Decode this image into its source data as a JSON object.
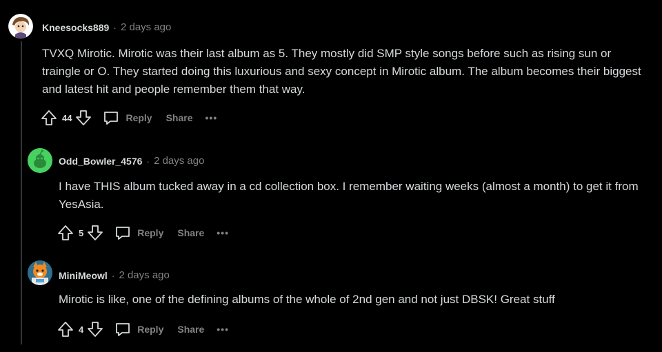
{
  "comments": [
    {
      "author": "Kneesocks889",
      "separator": "·",
      "time": "2 days ago",
      "body": "TVXQ Mirotic. Mirotic was their last album as 5. They mostly did SMP style songs before such as rising sun or traingle or O. They started doing this luxurious and sexy concept in Mirotic album. The album becomes their biggest and latest hit and people remember them that way.",
      "score": "44",
      "reply_label": "Reply",
      "share_label": "Share",
      "more_label": "•••"
    },
    {
      "author": "Odd_Bowler_4576",
      "separator": "·",
      "time": "2 days ago",
      "body": "I have THIS album tucked away in a cd collection box. I remember waiting weeks (almost a month) to get it from YesAsia.",
      "score": "5",
      "reply_label": "Reply",
      "share_label": "Share",
      "more_label": "•••"
    },
    {
      "author": "MiniMeowl",
      "separator": "·",
      "time": "2 days ago",
      "body": "Mirotic is like, one of the defining albums of the whole of 2nd gen and not just DBSK! Great stuff",
      "score": "4",
      "reply_label": "Reply",
      "share_label": "Share",
      "more_label": "•••"
    }
  ],
  "colors": {
    "background": "#000000",
    "text": "#d7dadc",
    "muted": "#818384",
    "avatar_green": "#46d160"
  }
}
